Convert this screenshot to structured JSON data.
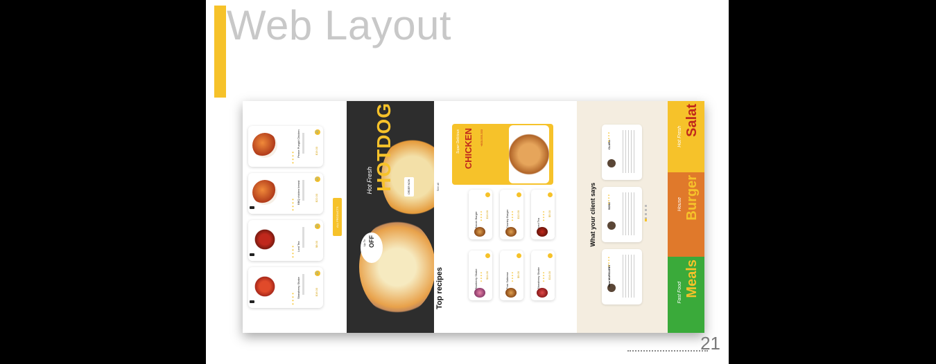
{
  "slide": {
    "title": "Web Layout",
    "page_number": "21",
    "accent_color": "#f6c22a"
  },
  "mockup": {
    "products": [
      {
        "name": "Penne Pungid Chicken",
        "price": "$19.00"
      },
      {
        "name": "BBQ chicken breast",
        "price": "$22.00"
      },
      {
        "name": "Lord Tea",
        "price": "$8.00"
      },
      {
        "name": "Strawberry Shake",
        "price": "$16.00"
      }
    ],
    "all_products_label": "ALL PRODUCTS",
    "hero": {
      "headline": "HOTDOG",
      "tagline": "Hot Fresh",
      "order_label": "ORDER NOW",
      "offer": "OFF",
      "offer_prefix": "Up To"
    },
    "promo": {
      "tagline": "Super Delicious",
      "title": "CHICKEN",
      "phone": "+800-555-333"
    },
    "recipes": {
      "title": "Top recipes",
      "see_all": "See all",
      "items": [
        {
          "name": "Bacon Burger",
          "price": "$10.00"
        },
        {
          "name": "Country Burger",
          "price": "$12.00"
        },
        {
          "name": "Iced Tea",
          "price": "$5.00"
        },
        {
          "name": "Blueberry Shake",
          "price": "$11.00"
        },
        {
          "name": "Pom Salteese",
          "price": "$9.00"
        },
        {
          "name": "Strawberry Shake",
          "price": "$14.00"
        }
      ]
    },
    "testimonials": {
      "title": "What your client says",
      "items": [
        {
          "name": "CLARA"
        },
        {
          "name": "SOSE"
        },
        {
          "name": "Nina MARGARET"
        }
      ]
    },
    "strips": [
      {
        "label": "Salat",
        "tagline": "Hot Fresh",
        "color": "#f6c22a",
        "text_color": "#c0281c"
      },
      {
        "label": "Burger",
        "tagline": "House",
        "color": "#e0792b",
        "text_color": "#f6c22a"
      },
      {
        "label": "Meals",
        "tagline": "Fast Food",
        "color": "#3aaa3a",
        "text_color": "#f6c22a"
      }
    ]
  }
}
